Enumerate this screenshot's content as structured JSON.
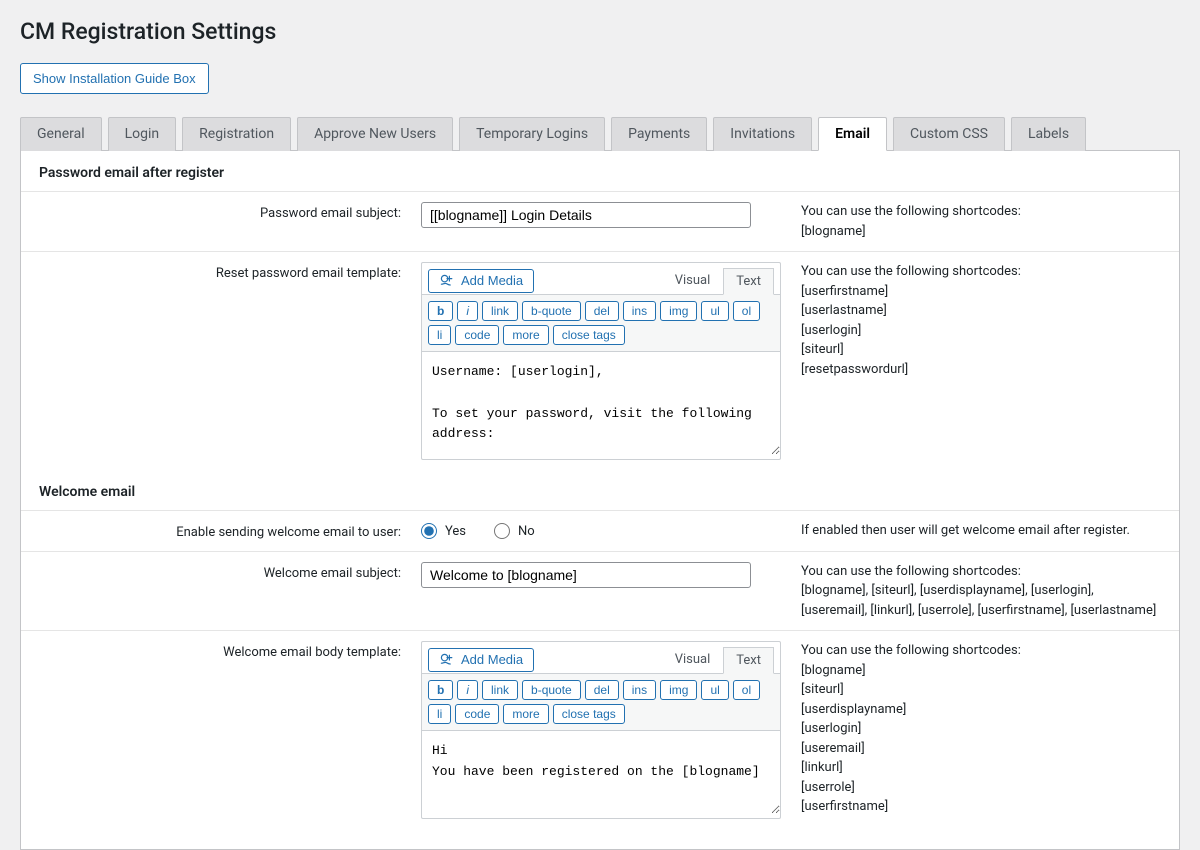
{
  "page_title": "CM Registration Settings",
  "install_guide_button": "Show Installation Guide Box",
  "tabs": [
    "General",
    "Login",
    "Registration",
    "Approve New Users",
    "Temporary Logins",
    "Payments",
    "Invitations",
    "Email",
    "Custom CSS",
    "Labels"
  ],
  "active_tab": "Email",
  "section_password": {
    "title": "Password email after register",
    "subject_label": "Password email subject:",
    "subject_value": "[[blogname]] Login Details",
    "subject_help_intro": "You can use the following shortcodes:",
    "subject_help_codes": [
      "[blogname]"
    ],
    "template_label": "Reset password email template:",
    "template_value": "Username: [userlogin],\n\nTo set your password, visit the following address:",
    "template_help_intro": "You can use the following shortcodes:",
    "template_help_codes": [
      "[userfirstname]",
      "[userlastname]",
      "[userlogin]",
      "[siteurl]",
      "[resetpasswordurl]"
    ]
  },
  "section_welcome": {
    "title": "Welcome email",
    "enable_label": "Enable sending welcome email to user:",
    "enable_help": "If enabled then user will get welcome email after register.",
    "enable_yes": "Yes",
    "enable_no": "No",
    "enable_value": "yes",
    "subject_label": "Welcome email subject:",
    "subject_value": "Welcome to [blogname]",
    "subject_help_intro": "You can use the following shortcodes:",
    "subject_help_line": "[blogname], [siteurl], [userdisplayname], [userlogin], [useremail], [linkurl], [userrole], [userfirstname], [userlastname]",
    "template_label": "Welcome email body template:",
    "template_value": "Hi\nYou have been registered on the [blogname]",
    "template_help_intro": "You can use the following shortcodes:",
    "template_help_codes": [
      "[blogname]",
      "[siteurl]",
      "[userdisplayname]",
      "[userlogin]",
      "[useremail]",
      "[linkurl]",
      "[userrole]",
      "[userfirstname]"
    ]
  },
  "editor": {
    "add_media": "Add Media",
    "visual": "Visual",
    "text": "Text",
    "buttons": {
      "b": "b",
      "i": "i",
      "link": "link",
      "bquote": "b-quote",
      "del": "del",
      "ins": "ins",
      "img": "img",
      "ul": "ul",
      "ol": "ol",
      "li": "li",
      "code": "code",
      "more": "more",
      "close": "close tags"
    }
  }
}
